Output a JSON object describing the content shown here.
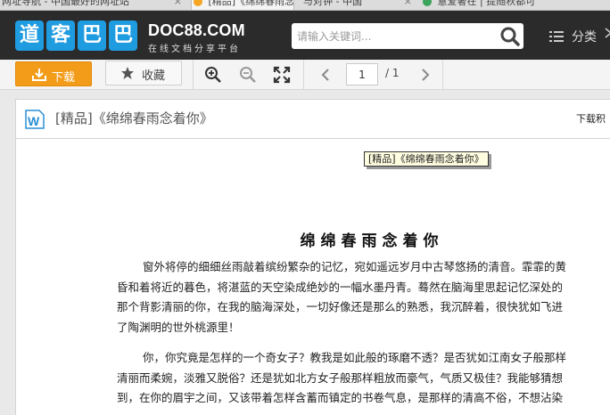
{
  "browser": {
    "tabs": [
      {
        "label": "网址导航 - 中国最好的网址站",
        "close": "×"
      },
      {
        "label": "[精品]《绵绵春雨念着你",
        "close": "×"
      },
      {
        "label": "与对钟 - 中国",
        "close": "×"
      },
      {
        "label": "意爱奢在 | 提随秋都可",
        "close": "×"
      }
    ]
  },
  "site": {
    "logo_chars": [
      "道",
      "客",
      "巴",
      "巴"
    ],
    "brand_name": "DOC88.COM",
    "brand_tagline": "在线文档分享平台",
    "search_placeholder": "请输入关键词...",
    "category_label": "分类"
  },
  "toolbar": {
    "download_label": "下载",
    "favorite_label": "收藏",
    "current_page": "1",
    "total_pages": "/ 1"
  },
  "document": {
    "title": "[精品]《绵绵春雨念着你》",
    "download_points_label": "下载积",
    "header_tag": "[精品]《绵绵春雨念着你》",
    "heading": "绵绵春雨念着你",
    "paragraphs": [
      {
        "lines": [
          "窗外将停的细细丝雨敲着缤纷繁杂的记忆，宛如遥远岁月中古琴悠扬的清音。霏霏的黄",
          "昏和着将近的暮色，将湛蓝的天空染成绝妙的一幅水墨丹青。蓦然在脑海里思起记忆深处的",
          "那个背影清丽的你，在我的脑海深处，一切好像还是那么的熟悉，我沉醉着，很快犹如飞进",
          "了陶渊明的世外桃源里！"
        ]
      },
      {
        "lines": [
          "你，你究竟是怎样的一个奇女子？教我是如此般的琢磨不透？是否犹如江南女子般那样",
          "清丽而柔婉，淡雅又脱俗？还是犹如北方女子般那样粗放而豪气，气质又极佳？我能够猜想",
          "到，在你的眉宇之间，又该带着怎样含蓄而镇定的书卷气息，是那样的清高不俗，不想沾染"
        ]
      }
    ]
  },
  "colors": {
    "header_bg": "#2b2b2b",
    "logo_blue": "#1f9be0",
    "download_orange": "#f39c1a"
  }
}
